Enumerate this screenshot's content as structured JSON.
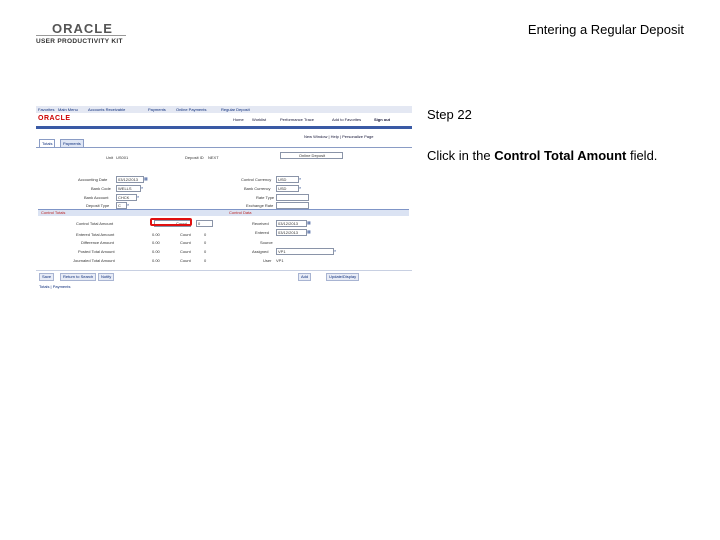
{
  "header": {
    "logo_text": "ORACLE",
    "logo_subtitle": "USER PRODUCTIVITY KIT",
    "doc_title": "Entering a Regular Deposit"
  },
  "instruction": {
    "step": "Step 22",
    "prefix": "Click in the ",
    "target": "Control Total Amount",
    "suffix": " field."
  },
  "screenshot": {
    "nav": [
      "Favorites",
      "Main Menu",
      "Accounts Receivable",
      "Payments",
      "Online Payments",
      "Regular Deposit"
    ],
    "brand": "ORACLE",
    "top_links": [
      "Home",
      "Worklist",
      "Performance Trace",
      "Add to Favorites",
      "Sign out"
    ],
    "page_links": "New Window | Help | Personalize Page",
    "tabs": [
      "Totals",
      "Payments"
    ],
    "unit_label": "Unit",
    "unit_value": "US001",
    "deposit_id_label": "Deposit ID",
    "deposit_id_value": "NEXT",
    "status_value": "Online Deposit",
    "left_fields": [
      {
        "label": "Accounting Date",
        "value": "03/12/2013"
      },
      {
        "label": "Bank Code",
        "value": "WELLS"
      },
      {
        "label": "Bank Account",
        "value": "CHCK"
      },
      {
        "label": "Deposit Type",
        "value": "C"
      }
    ],
    "right_fields": [
      {
        "label": "Control Currency",
        "value": "USD"
      },
      {
        "label": "Bank Currency",
        "value": "USD"
      },
      {
        "label": "Rate Type",
        "value": ""
      },
      {
        "label": "Exchange Rate",
        "value": ""
      }
    ],
    "control_totals_title": "Control Totals",
    "control_data_title": "Control Data",
    "total_rows": [
      {
        "label": "Control Total Amount",
        "value": "",
        "count_label": "Count",
        "count": "0"
      },
      {
        "label": "Entered Total Amount",
        "value": "0.00",
        "count_label": "Count",
        "count": "0"
      },
      {
        "label": "Difference Amount",
        "value": "0.00",
        "count_label": "Count",
        "count": "0"
      },
      {
        "label": "Posted Total Amount",
        "value": "0.00",
        "count_label": "Count",
        "count": "0"
      },
      {
        "label": "Journaled Total Amount",
        "value": "0.00",
        "count_label": "Count",
        "count": "0"
      }
    ],
    "data_rows": [
      {
        "label": "Received",
        "value": "03/12/2013"
      },
      {
        "label": "Entered",
        "value": "03/12/2013"
      },
      {
        "label": "Source",
        "value": ""
      },
      {
        "label": "Assigned",
        "value": "VP1"
      },
      {
        "label": "User",
        "value": "VP1"
      }
    ],
    "buttons": [
      "Save",
      "Return to Search",
      "Notify"
    ],
    "right_buttons": [
      "Add",
      "Update/Display"
    ],
    "footer_text": "Totals | Payments"
  }
}
